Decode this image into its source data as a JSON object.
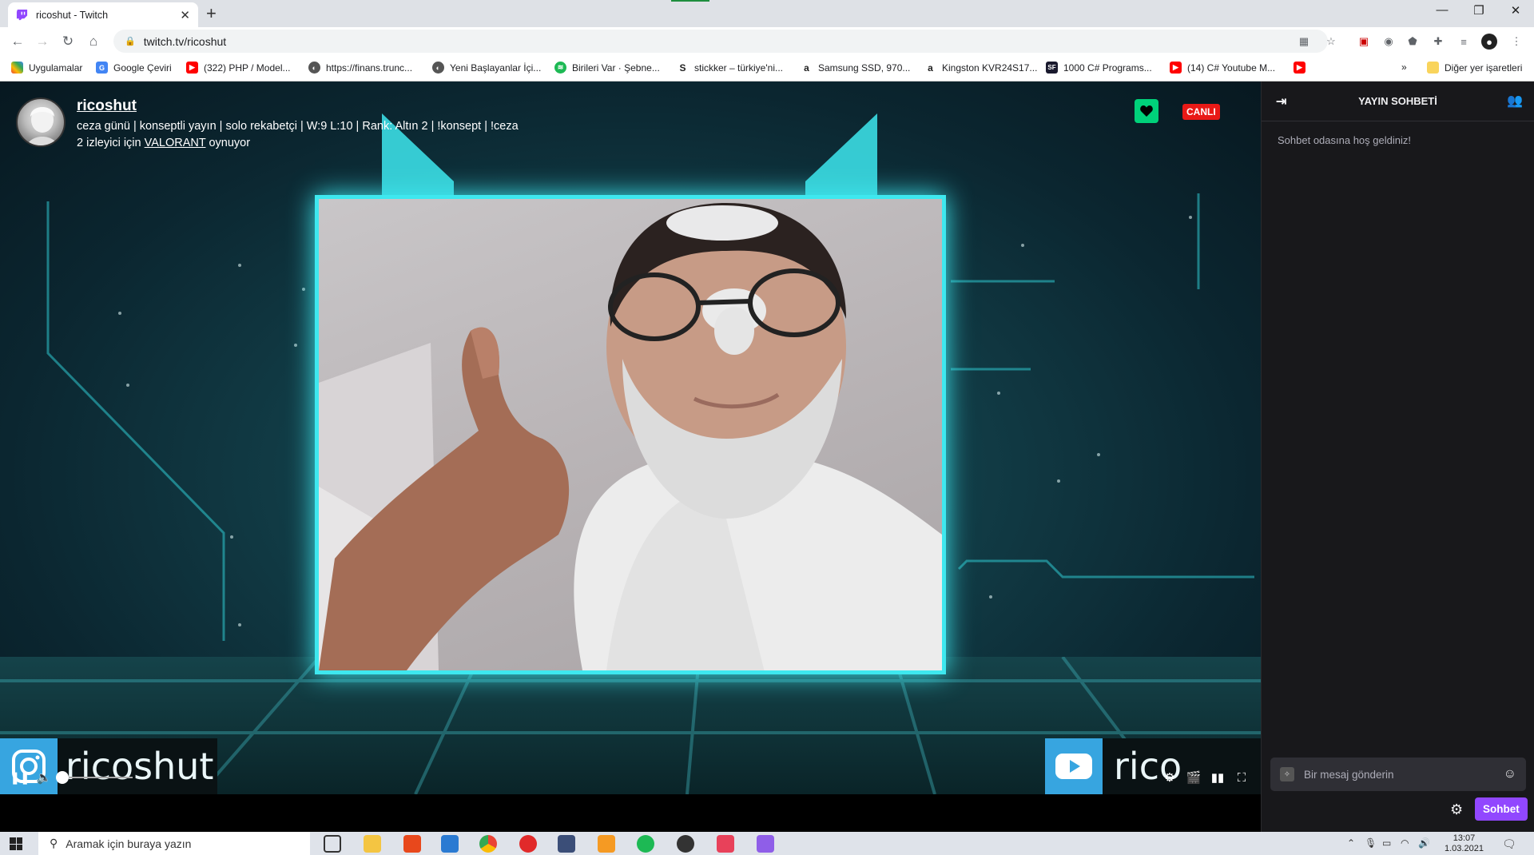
{
  "browser": {
    "tab_title": "ricoshut - Twitch",
    "url": "twitch.tv/ricoshut",
    "bookmarks": [
      {
        "label": "Uygulamalar",
        "icon": "apps-grid-icon",
        "color": "#ea4335"
      },
      {
        "label": "Google Çeviri",
        "icon": "google-translate-icon",
        "color": "#4285f4"
      },
      {
        "label": "(322) PHP / Model...",
        "icon": "youtube-icon",
        "color": "#ff0000"
      },
      {
        "label": "https://finans.trunc...",
        "icon": "globe-icon",
        "color": "#555555"
      },
      {
        "label": "Yeni Başlayanlar İçi...",
        "icon": "globe-icon",
        "color": "#555555"
      },
      {
        "label": "Birileri Var · Şebne...",
        "icon": "spotify-icon",
        "color": "#1db954"
      },
      {
        "label": "stickker – türkiye'ni...",
        "icon": "stickker-icon",
        "color": "#222222"
      },
      {
        "label": "Samsung SSD, 970...",
        "icon": "amazon-icon",
        "color": "#222222"
      },
      {
        "label": "Kingston KVR24S17...",
        "icon": "amazon-icon",
        "color": "#222222"
      },
      {
        "label": "1000 C# Programs...",
        "icon": "sf-icon",
        "color": "#1a1a2e"
      },
      {
        "label": "(14) C# Youtube M...",
        "icon": "youtube-icon",
        "color": "#ff0000"
      },
      {
        "label": "",
        "icon": "youtube-icon",
        "color": "#ff0000"
      }
    ],
    "more_bookmarks": "»",
    "other_bookmarks": "Diğer yer işaretleri"
  },
  "stream": {
    "channel_name": "ricoshut",
    "title": "ceza günü | konseptli yayın | solo rekabetçi | W:9 L:10 | Rank: Altın 2 | !konsept | !ceza",
    "viewers_prefix": "2 izleyici için",
    "game": "VALORANT",
    "viewers_suffix": "oynuyor",
    "live_badge": "CANLI",
    "overlay_instagram": "ricoshut",
    "overlay_youtube": "rico"
  },
  "chat": {
    "header": "YAYIN SOHBETİ",
    "welcome": "Sohbet odasına hoş geldiniz!",
    "input_placeholder": "Bir mesaj gönderin",
    "send_button": "Sohbet"
  },
  "taskbar": {
    "search_placeholder": "Aramak için buraya yazın",
    "time": "13:07",
    "date": "1.03.2021"
  },
  "colors": {
    "twitch_purple": "#9147ff",
    "live_red": "#e91916",
    "follow_green": "#00d17a",
    "frame_cyan": "#3ee8ef"
  }
}
